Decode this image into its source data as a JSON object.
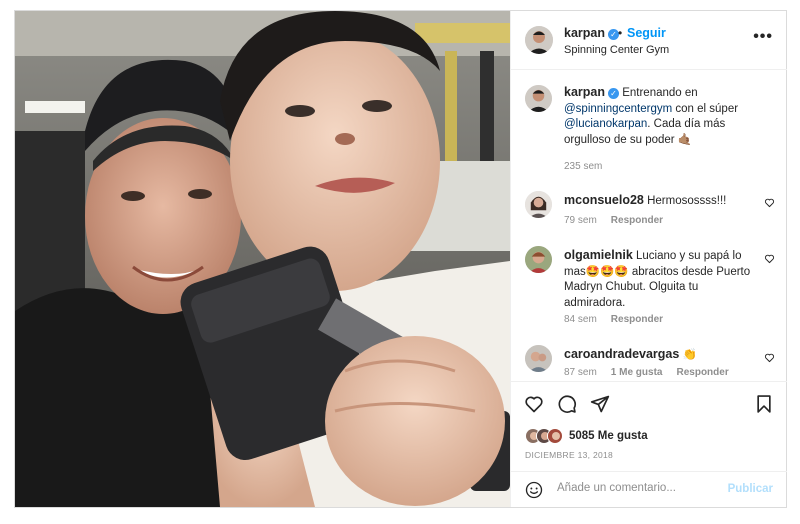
{
  "header": {
    "username": "karpan",
    "separator": "•",
    "follow_label": "Seguir",
    "location": "Spinning Center Gym",
    "more_icon": "more-horizontal-icon"
  },
  "caption": {
    "username": "karpan",
    "text_before": "Entrenando en",
    "mention1": "@spinningcentergym",
    "text_mid": "con el súper",
    "mention2": "@lucianokarpan",
    "text_after": ". Cada día más orgulloso de su poder 🤙🏽",
    "time": "235 sem"
  },
  "comments": [
    {
      "username": "mconsuelo28",
      "text": "Hermosossss!!!",
      "time": "79 sem",
      "likes": "",
      "reply": "Responder"
    },
    {
      "username": "olgamielnik",
      "text": "Luciano y su papá lo mas🤩🤩🤩 abracitos desde Puerto Madryn Chubut. Olguita tu admiradora.",
      "time": "84 sem",
      "likes": "",
      "reply": "Responder"
    },
    {
      "username": "caroandradevargas",
      "text": "👏",
      "time": "87 sem",
      "likes": "1 Me gusta",
      "reply": "Responder"
    }
  ],
  "actions": {
    "like_icon": "heart-icon",
    "comment_icon": "comment-icon",
    "share_icon": "send-icon",
    "save_icon": "bookmark-icon"
  },
  "likes_label": "5085 Me gusta",
  "date": "DICIEMBRE 13, 2018",
  "add_comment": {
    "placeholder": "Añade un comentario...",
    "publish_label": "Publicar",
    "emoji_icon": "emoji-icon"
  },
  "colors": {
    "accent": "#0095f6",
    "verified": "#3897f0",
    "muted": "#8e8e8e",
    "publish_disabled": "#b2dffc"
  }
}
